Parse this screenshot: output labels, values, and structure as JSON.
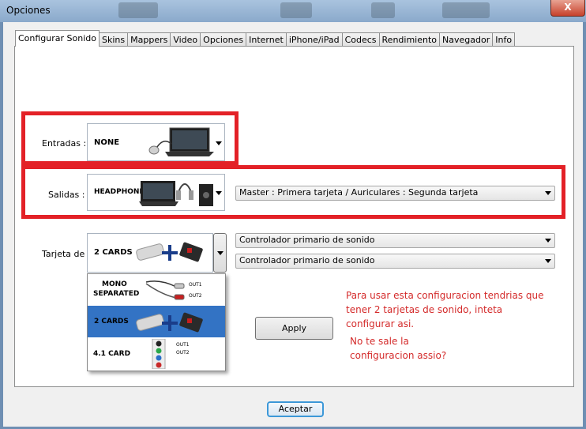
{
  "window": {
    "title": "Opciones",
    "close_glyph": "X"
  },
  "tabs": [
    "Configurar Sonido",
    "Skins",
    "Mappers",
    "Video",
    "Opciones",
    "Internet",
    "iPhone/iPad",
    "Codecs",
    "Rendimiento",
    "Navegador",
    "Info"
  ],
  "entradas": {
    "label": "Entradas :",
    "value": "NONE"
  },
  "salidas": {
    "label": "Salidas :",
    "value": "HEADPHONES",
    "mode": "Master : Primera tarjeta / Auriculares : Segunda tarjeta"
  },
  "tarjeta": {
    "label": "Tarjeta de",
    "value": "2 CARDS",
    "controller1": "Controlador primario de sonido",
    "controller2": "Controlador primario de sonido"
  },
  "dropdown": {
    "options": [
      {
        "line1": "MONO",
        "line2": "SEPARATED",
        "out1": "OUT1",
        "out2": "OUT2"
      },
      {
        "label": "2 CARDS"
      },
      {
        "label": "4.1 CARD",
        "out1": "OUT1",
        "out2": "OUT2"
      }
    ]
  },
  "apply_label": "Apply",
  "note": {
    "line1": "Para usar esta configuracion tendrias que",
    "line2": "tener 2 tarjetas de sonido, inteta",
    "line3": "configurar asi.",
    "line4": "No te sale la",
    "line5": "configuracion assio?"
  },
  "accept_label": "Aceptar",
  "colors": {
    "highlight_red": "#e32127",
    "note_red": "#d42b2b",
    "selected_blue": "#3373c4"
  }
}
